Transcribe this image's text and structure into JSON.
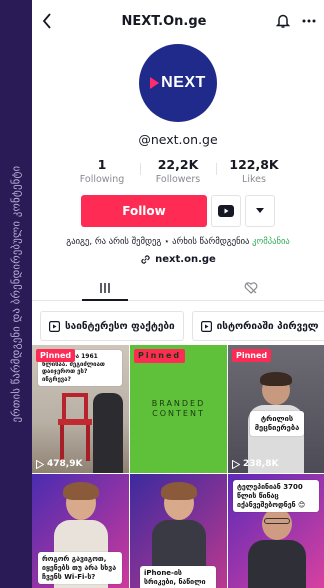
{
  "side_caption": "ერთის წარმდგენი და ბრენდირებული კონტენტი",
  "header": {
    "title": "NEXT.On.ge"
  },
  "profile": {
    "logo_text": "NEXT",
    "username": "@next.on.ge",
    "stats": [
      {
        "value": "1",
        "label": "Following"
      },
      {
        "value": "22,2K",
        "label": "Followers"
      },
      {
        "value": "122,8K",
        "label": "Likes"
      }
    ],
    "follow_label": "Follow",
    "bio_main": "გაიგე, რა არის შემდეგ ⋆ არხის წარმდგენია ",
    "bio_accent": "კომპანია",
    "link": "next.on.ge"
  },
  "playlists": [
    {
      "label": "საინტერესო ფაქტები"
    },
    {
      "label": "ისტორიაში პირველ"
    }
  ],
  "videos": [
    {
      "pinned": "Pinned",
      "views": "478,9K",
      "caption": "ჩემი სკოლა 1961 წლისაა. შეგიძლიათ დაიჯეროთ ეს? ინგრევა?"
    },
    {
      "pinned": "Pinned",
      "branded": "BRANDED CONTENT"
    },
    {
      "pinned": "Pinned",
      "views": "238,8K",
      "caption": "ტრილის მეცნიერება"
    },
    {
      "caption": "როგორ გავიგოთ, იყენებს თუ არა სხვა ჩვენს Wi-Fi-ს?"
    },
    {
      "caption": "iPhone-ის სრიკები, ნაწილი 2"
    },
    {
      "caption": "ტელეპინიან 3700 წლის წინაც იქანვეშებოდნენ 😊"
    }
  ],
  "colors": {
    "accent": "#fe2c55",
    "bio_accent": "#2eab56",
    "avatar_bg": "#1f2a8a"
  }
}
